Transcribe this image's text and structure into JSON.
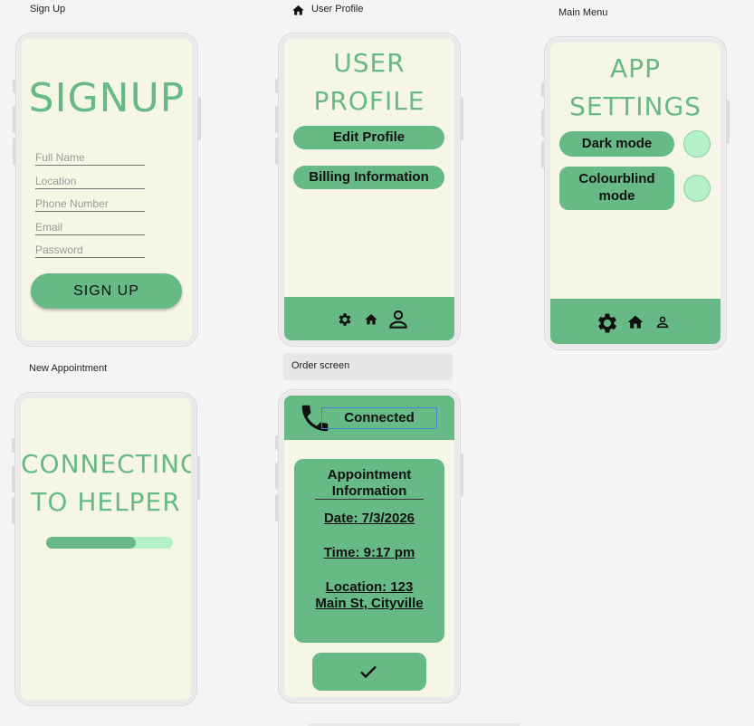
{
  "frames": {
    "signup": {
      "label": "Sign Up"
    },
    "profile": {
      "label": "User Profile"
    },
    "menu": {
      "label": "Main Menu"
    },
    "appointment": {
      "label": "New Appointment"
    },
    "order": {
      "label": "Order screen"
    }
  },
  "signup": {
    "title": "SIGNUP",
    "fields": {
      "full_name": "Full Name",
      "location": "Location",
      "phone": "Phone Number",
      "email": "Email",
      "password": "Password"
    },
    "button": "SIGN UP"
  },
  "profile": {
    "title_line1": "USER",
    "title_line2": "PROFILE",
    "edit_button": "Edit Profile",
    "billing_button": "Billing Information"
  },
  "settings": {
    "title_line1": "APP",
    "title_line2": "SETTINGS",
    "dark_mode": "Dark mode",
    "colourblind_line1": "Colourblind",
    "colourblind_line2": "mode"
  },
  "appointment": {
    "title_line1": "CONNECTING",
    "title_line2": "TO HELPER",
    "progress": 0.71
  },
  "order": {
    "status": "Connected",
    "info_title_line1": "Appointment",
    "info_title_line2": "Information",
    "date": "Date: 7/3/2026",
    "time": "Time: 9:17 pm",
    "location_line1": "Location: 123",
    "location_line2": "Main St, Cityville"
  },
  "colors": {
    "accent": "#67b986",
    "screen": "#f5f6e6",
    "light_green": "#b4f0c8"
  },
  "icons": [
    "home-icon",
    "gear-icon",
    "person-icon",
    "phone-icon",
    "check-icon"
  ]
}
